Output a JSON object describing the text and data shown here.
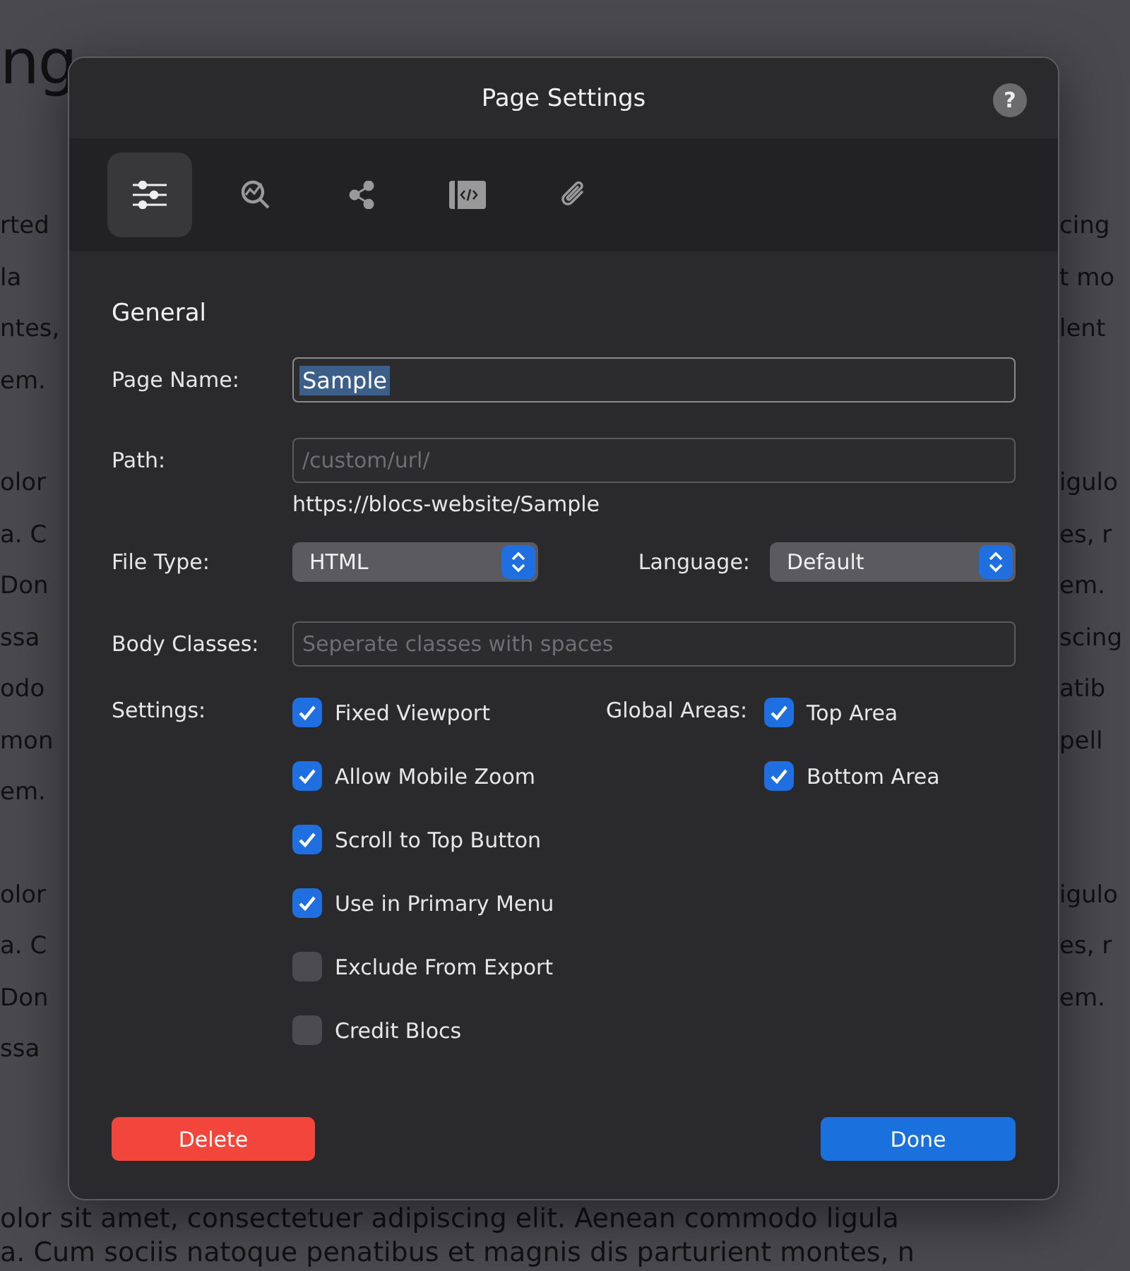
{
  "background": {
    "heading": "ng",
    "paragraphs": [
      [
        {
          "left": "rted",
          "right": "cing"
        },
        {
          "left": "la",
          "right": "t mo"
        },
        {
          "left": "ntes,",
          "right": "lent"
        },
        {
          "left": "em."
        }
      ],
      [
        {
          "left": "olor",
          "right": "igulo"
        },
        {
          "left": "a. C",
          "right": "es, r"
        },
        {
          "left": "Don",
          "right": "em."
        },
        {
          "left": "ssa",
          "right": "scing"
        },
        {
          "left": "odo",
          "right": "atib"
        },
        {
          "left": "mon",
          "right": "pell"
        },
        {
          "left": "em."
        }
      ],
      [
        {
          "left": "olor",
          "right": "igulo"
        },
        {
          "left": "a. C",
          "right": "es, r"
        },
        {
          "left": "Don",
          "right": "em."
        },
        {
          "left": "ssa"
        }
      ]
    ],
    "footer_lines": [
      "olor sit amet, consectetuer adipiscing elit. Aenean commodo ligula",
      "a. Cum sociis natoque penatibus et magnis dis parturient montes, n"
    ]
  },
  "dialog": {
    "title": "Page Settings",
    "help": "?",
    "tabs": [
      {
        "kind": "sliders",
        "selected": true
      },
      {
        "kind": "seo",
        "selected": false
      },
      {
        "kind": "share",
        "selected": false
      },
      {
        "kind": "code",
        "selected": false
      },
      {
        "kind": "attach",
        "selected": false
      }
    ],
    "section": "General",
    "page_name": {
      "label": "Page Name:",
      "value": "Sample"
    },
    "path": {
      "label": "Path:",
      "placeholder": "/custom/url/",
      "url": "https://blocs-website/Sample"
    },
    "file_type": {
      "label": "File Type:",
      "value": "HTML"
    },
    "language": {
      "label": "Language:",
      "value": "Default"
    },
    "body_classes": {
      "label": "Body Classes:",
      "placeholder": "Seperate classes with spaces"
    },
    "settings": {
      "label": "Settings:",
      "items": [
        {
          "label": "Fixed Viewport",
          "checked": true
        },
        {
          "label": "Allow Mobile Zoom",
          "checked": true
        },
        {
          "label": "Scroll to Top Button",
          "checked": true
        },
        {
          "label": "Use in Primary Menu",
          "checked": true
        },
        {
          "label": "Exclude From Export",
          "checked": false
        },
        {
          "label": "Credit Blocs",
          "checked": false
        }
      ]
    },
    "global_areas": {
      "label": "Global Areas:",
      "items": [
        {
          "label": "Top Area",
          "checked": true
        },
        {
          "label": "Bottom Area",
          "checked": true
        }
      ]
    },
    "buttons": {
      "delete": "Delete",
      "done": "Done"
    }
  }
}
